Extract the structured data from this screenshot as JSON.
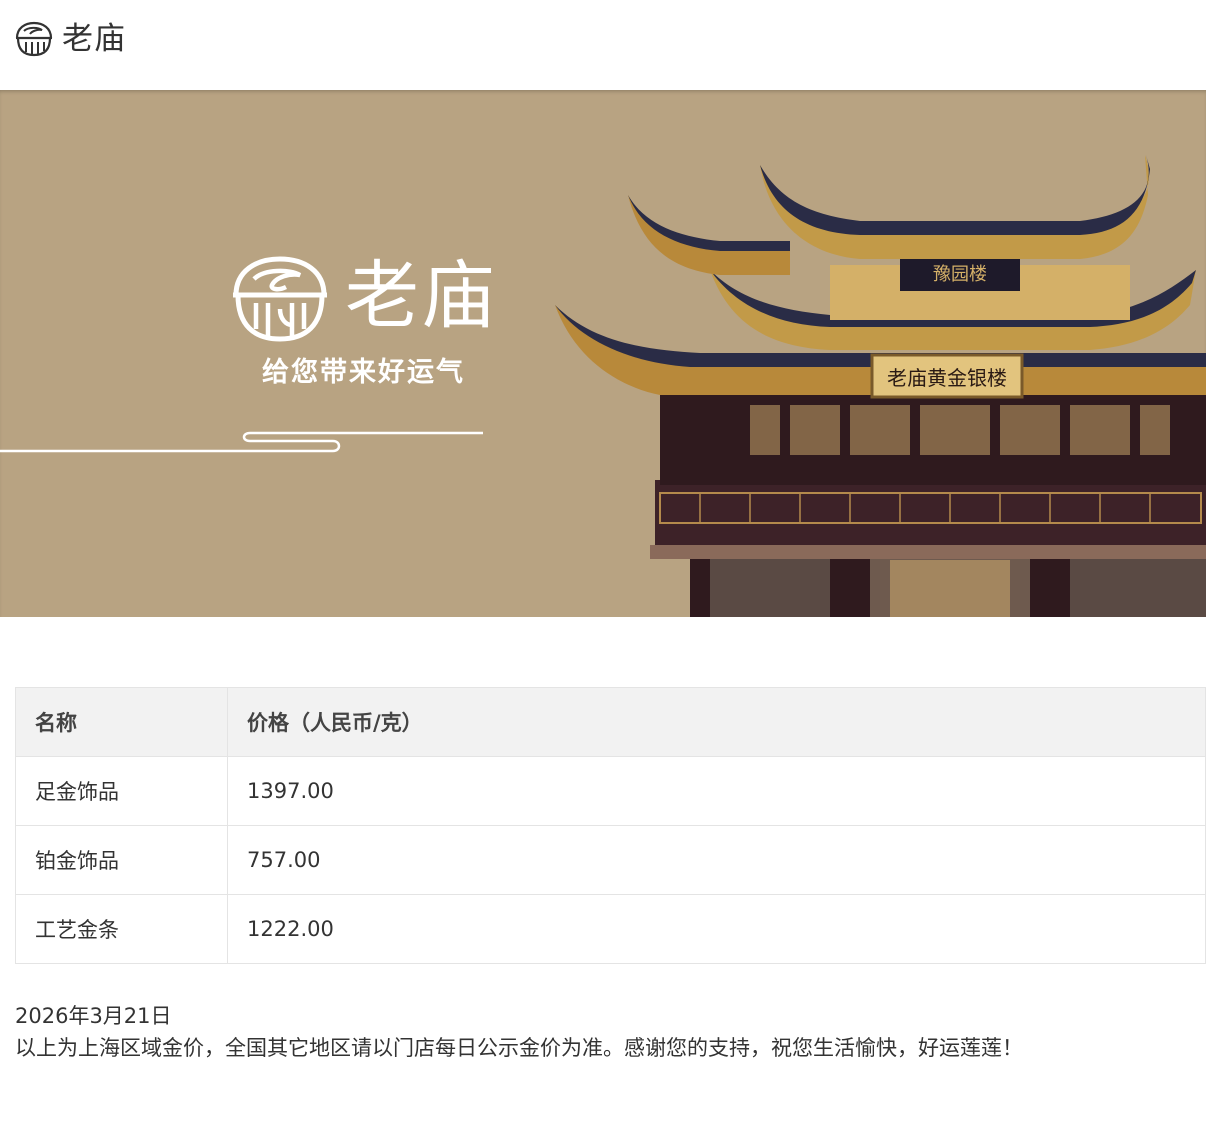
{
  "header": {
    "brand": "老庙",
    "logo_icon": "laomiao-logo-icon"
  },
  "banner": {
    "brand": "老庙",
    "slogan": "给您带来好运气",
    "sign_top": "豫园楼",
    "sign_main": "老庙黄金银楼",
    "building_image": "temple-building-image"
  },
  "table": {
    "headers": [
      "名称",
      "价格（人民币/克）"
    ],
    "rows": [
      {
        "name": "足金饰品",
        "price": "1397.00"
      },
      {
        "name": "铂金饰品",
        "price": "757.00"
      },
      {
        "name": "工艺金条",
        "price": "1222.00"
      }
    ]
  },
  "footer": {
    "date": "2026年3月21日",
    "note": "以上为上海区域金价，全国其它地区请以门店每日公示金价为准。感谢您的支持，祝您生活愉快，好运莲莲！"
  },
  "colors": {
    "banner_bg": "#b8a382",
    "table_header_bg": "#f2f2f2",
    "text": "#333333",
    "gold": "#c9a34a",
    "dark_wood": "#3a1e24"
  }
}
